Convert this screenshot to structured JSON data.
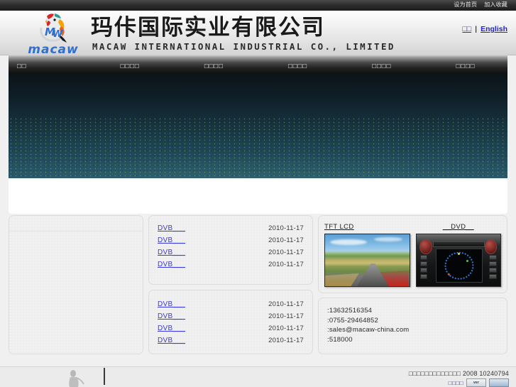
{
  "topbar": {
    "links": [
      {
        "label": "设为首页",
        "name": "set-homepage-link"
      },
      {
        "label": "加入收藏",
        "name": "add-favorite-link"
      }
    ]
  },
  "header": {
    "logo_word": "macaw",
    "logo_icon": "macaw-bird-logo",
    "company_cn": "玛佧国际实业有限公司",
    "company_en": "MACAW INTERNATIONAL INDUSTRIAL CO., LIMITED",
    "lang": {
      "chinese": "□□",
      "separator": "|",
      "english": "English"
    }
  },
  "nav": {
    "items": [
      {
        "label": "□□"
      },
      {
        "label": "□□□□"
      },
      {
        "label": "□□□□"
      },
      {
        "label": "□□□□"
      },
      {
        "label": "□□□□"
      },
      {
        "label": "□□□□"
      }
    ]
  },
  "banner": {
    "alt": "dark teal gradient banner"
  },
  "panels": {
    "left": {
      "title": ""
    },
    "news1": {
      "rows": [
        {
          "link": "DVB___",
          "date": "2010-11-17"
        },
        {
          "link": "DVB___",
          "date": "2010-11-17"
        },
        {
          "link": "DVB___",
          "date": "2010-11-17"
        },
        {
          "link": "DVB___",
          "date": "2010-11-17"
        }
      ]
    },
    "news2": {
      "rows": [
        {
          "link": "DVB___",
          "date": "2010-11-17"
        },
        {
          "link": "DVB___",
          "date": "2010-11-17"
        },
        {
          "link": "DVB___",
          "date": "2010-11-17"
        },
        {
          "link": "DVB___",
          "date": "2010-11-17"
        }
      ]
    },
    "products": {
      "items": [
        {
          "title": "TFT LCD",
          "image": "tft-lcd-landscape-photo"
        },
        {
          "title": "__DVD__",
          "image": "car-dvd-head-unit-photo"
        }
      ]
    },
    "contact": {
      "rows": [
        {
          "value": ":13632516354"
        },
        {
          "value": ":0755-29464852"
        },
        {
          "value": ":sales@macaw-china.com"
        },
        {
          "value": ":518000"
        }
      ]
    }
  },
  "footer": {
    "figure_icon": "person-figure-watermark",
    "copyright": "□□□□□□□□□□□□□ 2008  10240794",
    "badge_link": "□□□□",
    "badge_label": "ver",
    "badge_icon": "certification-badge-icon"
  },
  "colors": {
    "link_blue": "#3a3ae0",
    "nav_dark": "#1c1c1c",
    "banner_teal": "#20495a",
    "panel_bg": "#eeeeee"
  }
}
